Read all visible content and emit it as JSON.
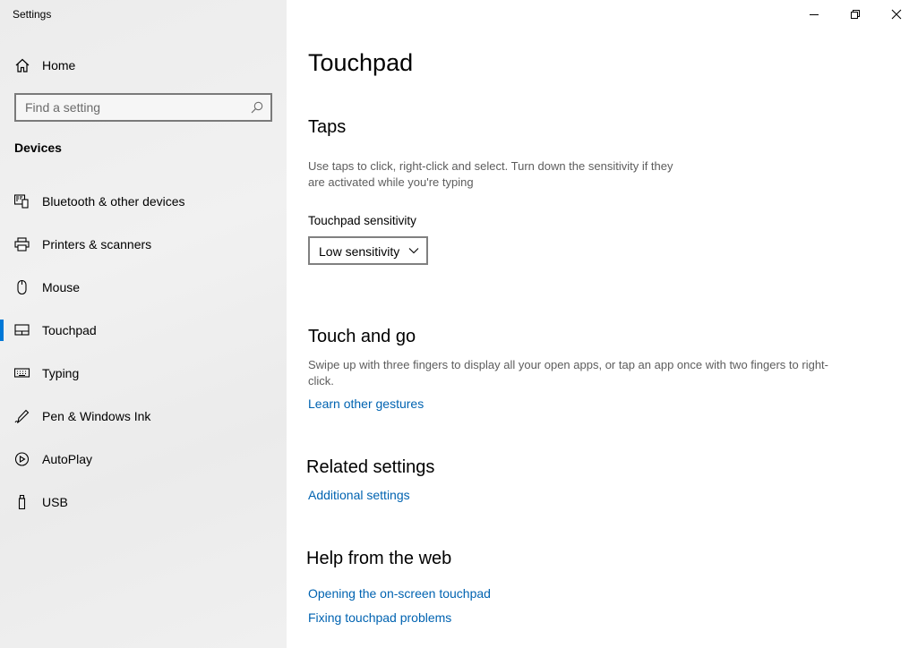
{
  "window": {
    "title": "Settings",
    "controls": {
      "minimize": "minimize",
      "restore": "restore",
      "close": "close"
    }
  },
  "sidebar": {
    "home_label": "Home",
    "search": {
      "placeholder": "Find a setting",
      "value": ""
    },
    "section_title": "Devices",
    "items": [
      {
        "label": "Bluetooth & other devices",
        "icon": "bluetooth-devices-icon",
        "selected": false
      },
      {
        "label": "Printers & scanners",
        "icon": "printer-icon",
        "selected": false
      },
      {
        "label": "Mouse",
        "icon": "mouse-icon",
        "selected": false
      },
      {
        "label": "Touchpad",
        "icon": "touchpad-icon",
        "selected": true
      },
      {
        "label": "Typing",
        "icon": "keyboard-icon",
        "selected": false
      },
      {
        "label": "Pen & Windows Ink",
        "icon": "pen-icon",
        "selected": false
      },
      {
        "label": "AutoPlay",
        "icon": "autoplay-icon",
        "selected": false
      },
      {
        "label": "USB",
        "icon": "usb-icon",
        "selected": false
      }
    ]
  },
  "main": {
    "title": "Touchpad",
    "taps": {
      "heading": "Taps",
      "description_line1": "Use taps to click, right-click and select. Turn down the sensitivity if they",
      "description_line2": "are activated while you're typing",
      "sensitivity_label": "Touchpad sensitivity",
      "sensitivity_value": "Low sensitivity"
    },
    "touch_and_go": {
      "heading": "Touch and go",
      "description_line1": "Swipe up with three fingers to display all your open apps, or tap an app once with two fingers to right-",
      "description_line2": "click.",
      "link": "Learn other gestures"
    },
    "related": {
      "heading": "Related settings",
      "link": "Additional settings"
    },
    "help": {
      "heading": "Help from the web",
      "links": [
        "Opening the on-screen touchpad",
        "Fixing touchpad problems"
      ]
    }
  },
  "colors": {
    "accent": "#0078d7",
    "link": "#0063b1",
    "sidebar_bg": "#eeeeee"
  }
}
